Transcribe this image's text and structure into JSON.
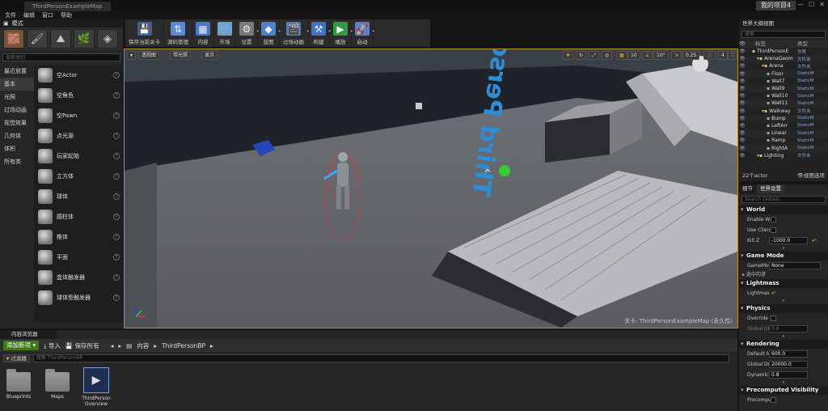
{
  "window": {
    "doc_tab": "ThirdPersonExampleMap",
    "project": "我的项目4"
  },
  "menu": [
    "文件",
    "编辑",
    "窗口",
    "帮助"
  ],
  "modes": {
    "tab": "模式",
    "search_placeholder": "搜索类别",
    "categories": [
      "最近放置",
      "基本",
      "光照",
      "过场动画",
      "视觉效果",
      "几何体",
      "体积",
      "所有类"
    ],
    "selected_category": 1,
    "items": [
      "空Actor",
      "空角色",
      "空Pawn",
      "点光源",
      "玩家起始",
      "立方体",
      "球体",
      "圆柱体",
      "椎体",
      "平面",
      "盒体触发器",
      "球体型触发器"
    ]
  },
  "toolbar": {
    "buttons": [
      {
        "label": "保存当前关卡",
        "icon": "save-icon"
      },
      {
        "label": "源码管理",
        "icon": "source-control-icon"
      },
      {
        "label": "内容",
        "icon": "content-icon"
      },
      {
        "label": "市场",
        "icon": "marketplace-icon"
      },
      {
        "label": "设置",
        "icon": "settings-icon"
      },
      {
        "label": "蓝图",
        "icon": "blueprint-icon"
      },
      {
        "label": "过场动画",
        "icon": "cinematics-icon"
      },
      {
        "label": "构建",
        "icon": "build-icon"
      },
      {
        "label": "播放",
        "icon": "play-icon"
      },
      {
        "label": "启动",
        "icon": "launch-icon"
      }
    ]
  },
  "viewport": {
    "perspective": "透视图",
    "lit": "带光照",
    "show": "显示",
    "grid_snap": "10",
    "rot_snap": "10°",
    "scale_snap": "0.25",
    "cam_speed": "4",
    "level_label": "关卡: ThirdPersonExampleMap (永久性)",
    "floor_text": "Third Person",
    "accent": "#b8912a"
  },
  "outliner": {
    "tab": "世界大纲视图",
    "search_placeholder": "搜索",
    "col_label": "标签",
    "col_type": "类型",
    "rows": [
      {
        "label": "ThirdPersonE",
        "type": "世界",
        "indent": 0
      },
      {
        "label": "ArenaGeom",
        "type": "文件夹",
        "indent": 1
      },
      {
        "label": "Arena",
        "type": "文件夹",
        "indent": 2
      },
      {
        "label": "Floor",
        "type": "StaticM",
        "indent": 3
      },
      {
        "label": "Wall7",
        "type": "StaticM",
        "indent": 3
      },
      {
        "label": "Wall9",
        "type": "StaticM",
        "indent": 3
      },
      {
        "label": "Wall10",
        "type": "StaticM",
        "indent": 3
      },
      {
        "label": "Wall11",
        "type": "StaticM",
        "indent": 3
      },
      {
        "label": "Walkway",
        "type": "文件夹",
        "indent": 2
      },
      {
        "label": "Bump",
        "type": "StaticM",
        "indent": 3
      },
      {
        "label": "LeftArr",
        "type": "StaticM",
        "indent": 3
      },
      {
        "label": "Linear",
        "type": "StaticM",
        "indent": 3
      },
      {
        "label": "Ramp",
        "type": "StaticM",
        "indent": 3
      },
      {
        "label": "RightA",
        "type": "StaticM",
        "indent": 3
      },
      {
        "label": "Lighting",
        "type": "文件夹",
        "indent": 1
      }
    ],
    "actor_count": "22个actor",
    "view_options": "视图选项"
  },
  "details": {
    "tabs": [
      "细节",
      "世界设置"
    ],
    "search_placeholder": "Search Details",
    "world_head": "World",
    "enable_wc": "Enable W",
    "use_client": "Use Clien",
    "kill_z_label": "Kill Z",
    "kill_z": "-1000.0",
    "game_mode_head": "Game Mode",
    "game_mode_label": "GameMo",
    "game_mode_value": "None",
    "selected_gamemode": "选中的游",
    "lightmass_head": "Lightmass",
    "lightmass_label": "Lightmas",
    "physics_head": "Physics",
    "override_label": "Override",
    "global_gravity_label": "Global Gr",
    "global_gravity": "0.0",
    "rendering_head": "Rendering",
    "default_max_label": "Default M",
    "default_max": "600.0",
    "global_dist_label": "Global Dr",
    "global_dist": "20000.0",
    "dynamic_label": "Dynamic",
    "dynamic": "0.8",
    "precomputed_head": "Precomputed Visibility",
    "precomputed_label": "Precompu"
  },
  "content_browser": {
    "tab": "内容浏览器",
    "add_new": "添加新项",
    "import": "导入",
    "save_all": "保存所有",
    "crumbs": [
      "内容",
      "ThirdPersonBP"
    ],
    "filter": "过滤器",
    "search_placeholder": "搜索 ThirdPersonBP",
    "assets": [
      {
        "label": "Blueprints",
        "kind": "folder"
      },
      {
        "label": "Maps",
        "kind": "folder"
      },
      {
        "label": "ThirdPerson Overview",
        "kind": "map"
      }
    ]
  }
}
